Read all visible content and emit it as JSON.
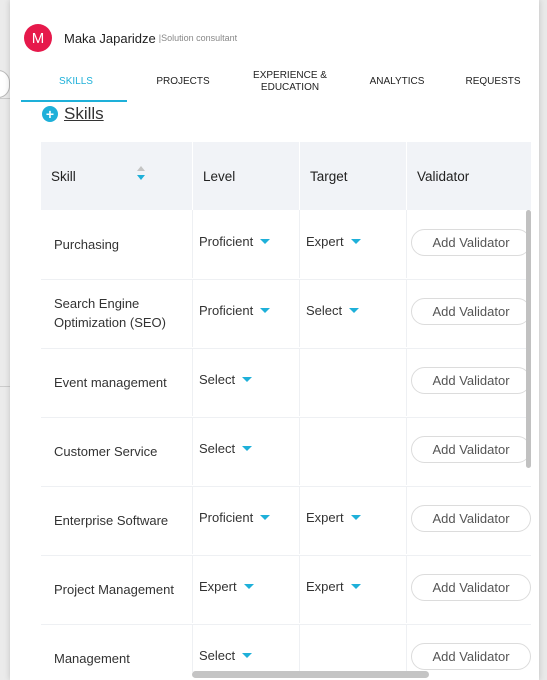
{
  "header": {
    "avatar_initial": "M",
    "user_name": "Maka Japaridze",
    "user_role": "|Solution consultant"
  },
  "tabs": [
    {
      "label": "SKILLS",
      "active": true
    },
    {
      "label": "PROJECTS",
      "active": false
    },
    {
      "label": "EXPERIENCE & EDUCATION",
      "active": false
    },
    {
      "label": "ANALYTICS",
      "active": false
    },
    {
      "label": "REQUESTS",
      "active": false
    }
  ],
  "section": {
    "title": "Skills",
    "add_icon": "plus-circle-icon"
  },
  "table": {
    "columns": [
      "Skill",
      "Level",
      "Target",
      "Validator"
    ],
    "rows": [
      {
        "skill": "Purchasing",
        "level": "Proficient",
        "target": "Expert",
        "validator": "Add Validator"
      },
      {
        "skill": "Search Engine Optimization (SEO)",
        "level": "Proficient",
        "target": "Select",
        "validator": "Add Validator"
      },
      {
        "skill": "Event management",
        "level": "Select",
        "target": "",
        "validator": "Add Validator"
      },
      {
        "skill": "Customer Service",
        "level": "Select",
        "target": "",
        "validator": "Add Validator"
      },
      {
        "skill": "Enterprise Software",
        "level": "Proficient",
        "target": "Expert",
        "validator": "Add Validator"
      },
      {
        "skill": "Project Management",
        "level": "Expert",
        "target": "Expert",
        "validator": "Add Validator"
      },
      {
        "skill": "Management",
        "level": "Select",
        "target": "",
        "validator": "Add Validator"
      }
    ]
  },
  "colors": {
    "accent": "#1eb0d9",
    "avatar": "#e6194b"
  }
}
